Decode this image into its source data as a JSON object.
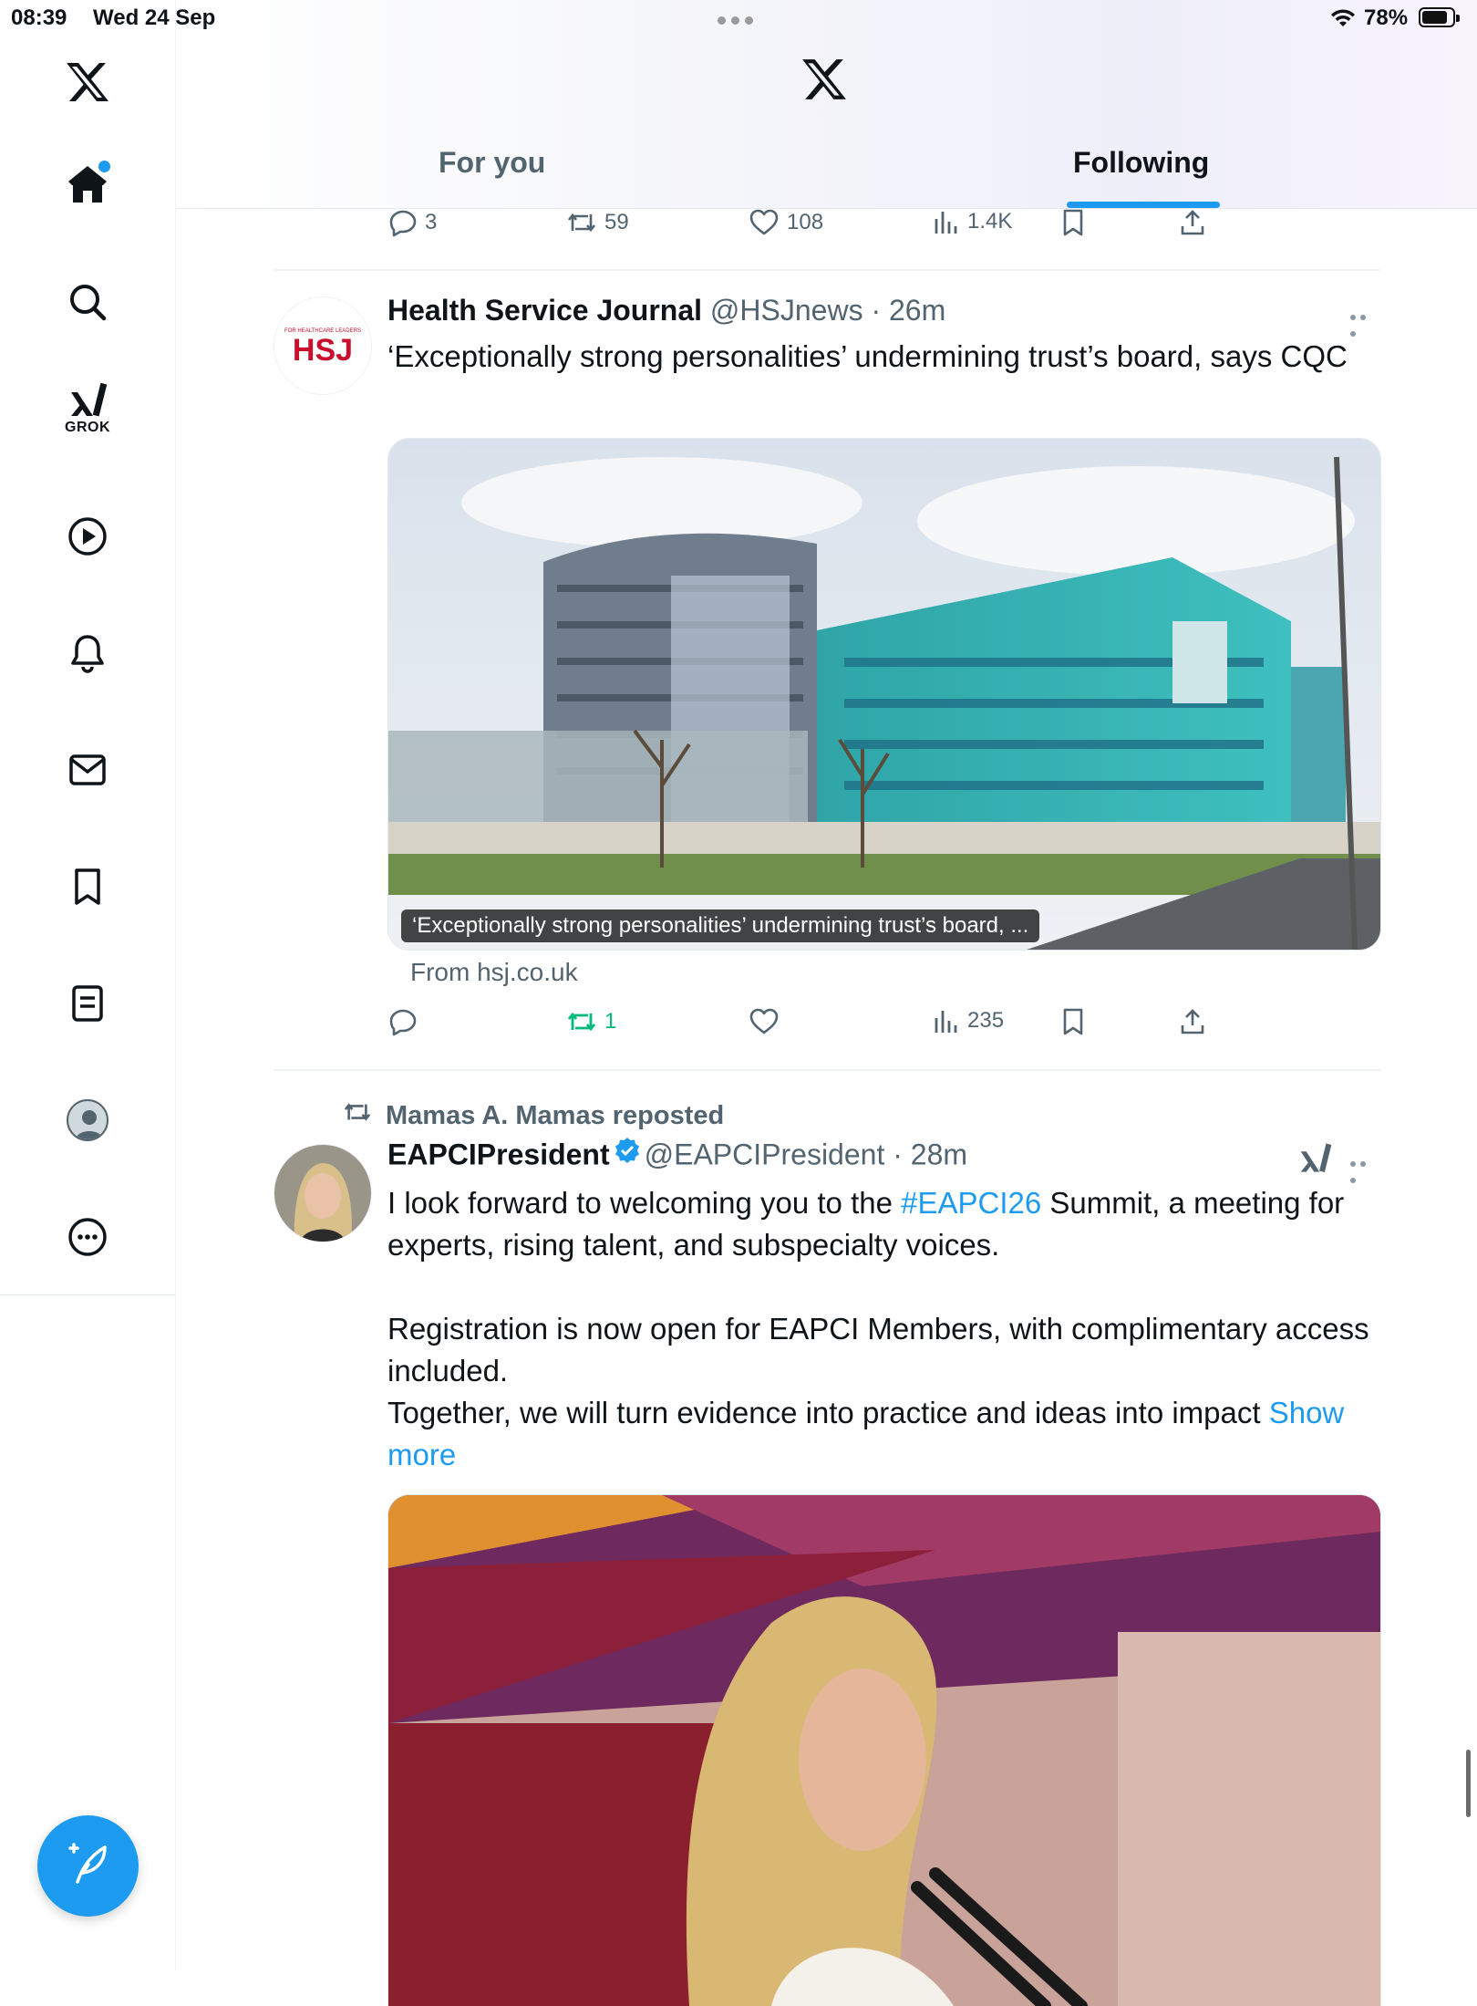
{
  "status_bar": {
    "time": "08:39",
    "date": "Wed 24 Sep",
    "battery": "78%",
    "battery_level": 0.78
  },
  "sidebar": {
    "grok_label": "GROK",
    "items": [
      {
        "name": "home",
        "icon": "home-icon"
      },
      {
        "name": "explore",
        "icon": "search-icon"
      },
      {
        "name": "grok",
        "icon": "grok-icon"
      },
      {
        "name": "video",
        "icon": "play-icon"
      },
      {
        "name": "notifications",
        "icon": "bell-icon"
      },
      {
        "name": "messages",
        "icon": "mail-icon"
      },
      {
        "name": "bookmarks",
        "icon": "bookmark-icon"
      },
      {
        "name": "lists",
        "icon": "list-icon"
      },
      {
        "name": "profile",
        "icon": "avatar"
      },
      {
        "name": "more",
        "icon": "more-icon"
      }
    ],
    "compose_icon": "compose-icon"
  },
  "header": {
    "tabs": [
      {
        "label": "For you",
        "active": false
      },
      {
        "label": "Following",
        "active": true
      }
    ]
  },
  "top_actions": {
    "replies": "3",
    "reposts": "59",
    "likes": "108",
    "views": "1.4K"
  },
  "posts": [
    {
      "name": "Health Service Journal",
      "handle": "@HSJnews",
      "time": "· 26m",
      "avatar_text": "HSJ",
      "avatar_subtext": "FOR HEALTHCARE LEADERS",
      "text": "‘Exceptionally strong personalities’ undermining trust’s board, says CQC",
      "card_caption": "‘Exceptionally strong personalities’ undermining trust’s board, ...",
      "card_source": "From hsj.co.uk",
      "actions": {
        "replies": "",
        "reposts": "1",
        "likes": "",
        "views": "235"
      }
    },
    {
      "reposted_by": "Mamas A. Mamas reposted",
      "name": "EAPCIPresident",
      "handle": "@EAPCIPresident",
      "time": "· 28m",
      "verified": true,
      "text_1_a": "I look forward to welcoming you to the ",
      "hashtag": "#EAPCI26",
      "text_1_b": " Summit, a meeting for experts, rising talent, and subspecialty voices.",
      "text_2": "Registration is now open for EAPCI Members, with complimentary access included.",
      "text_3": "Together, we will turn evidence into practice and ideas into impact",
      "show_more": "Show more"
    }
  ],
  "colors": {
    "accent": "#1d9bf0",
    "retweet_green": "#00ba7c",
    "secondary_text": "#536471"
  }
}
